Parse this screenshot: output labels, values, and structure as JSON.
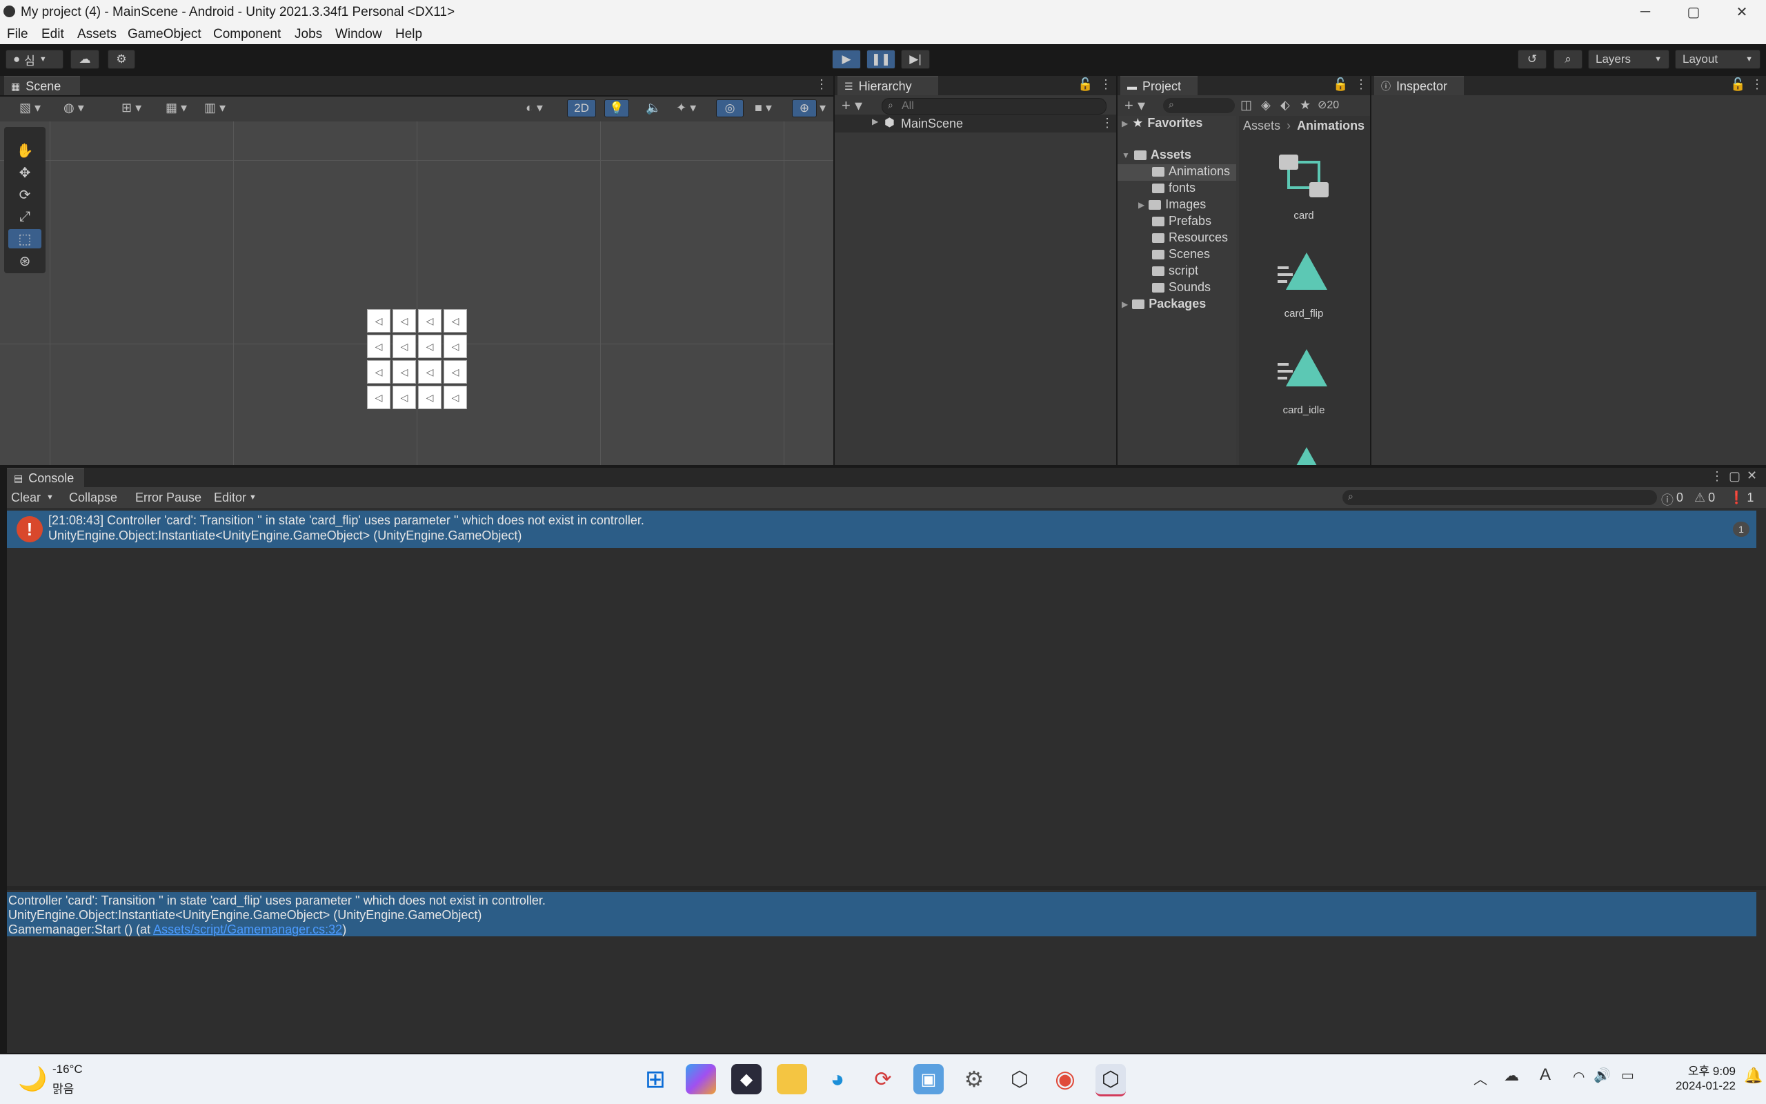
{
  "window": {
    "title": "My project (4) - MainScene - Android - Unity 2021.3.34f1 Personal <DX11>",
    "min_glyph": "─",
    "max_glyph": "▢",
    "close_glyph": "✕"
  },
  "menu": [
    "File",
    "Edit",
    "Assets",
    "GameObject",
    "Component",
    "Jobs",
    "Window",
    "Help"
  ],
  "toolbar": {
    "account_label": "심",
    "layers_label": "Layers",
    "layout_label": "Layout"
  },
  "scene": {
    "tab_label": "Scene",
    "mode_2d_label": "2D",
    "card_glyph": "◁"
  },
  "hierarchy": {
    "tab_label": "Hierarchy",
    "search_placeholder": "All",
    "root_item": "MainScene"
  },
  "project": {
    "tab_label": "Project",
    "favorites_label": "Favorites",
    "assets_label": "Assets",
    "packages_label": "Packages",
    "folders": [
      "Animations",
      "fonts",
      "Images",
      "Prefabs",
      "Resources",
      "Scenes",
      "script",
      "Sounds"
    ],
    "breadcrumb_root": "Assets",
    "breadcrumb_current": "Animations",
    "hidden_count": "20",
    "assets": [
      {
        "name": "card",
        "icon": "animator-controller-icon"
      },
      {
        "name": "card_flip",
        "icon": "animation-clip-icon"
      },
      {
        "name": "card_idle",
        "icon": "animation-clip-icon"
      }
    ]
  },
  "inspector": {
    "tab_label": "Inspector"
  },
  "console": {
    "tab_label": "Console",
    "clear_label": "Clear",
    "collapse_label": "Collapse",
    "error_pause_label": "Error Pause",
    "editor_label": "Editor",
    "info_count": "0",
    "warn_count": "0",
    "error_count": "1",
    "entry": {
      "line1": "[21:08:43] Controller 'card': Transition '' in state 'card_flip' uses parameter '' which does not exist in controller.",
      "line2": "UnityEngine.Object:Instantiate<UnityEngine.GameObject> (UnityEngine.GameObject)",
      "count": "1"
    },
    "detail": {
      "line1": "Controller 'card': Transition '' in state 'card_flip' uses parameter '' which does not exist in controller.",
      "line2": "UnityEngine.Object:Instantiate<UnityEngine.GameObject> (UnityEngine.GameObject)",
      "line3_prefix": "Gamemanager:Start () (at ",
      "line3_link": "Assets/script/Gamemanager.cs:32",
      "line3_suffix": ")"
    }
  },
  "taskbar": {
    "temperature": "-16°C",
    "weather": "맑음",
    "time": "오후 9:09",
    "date": "2024-01-22"
  },
  "colors": {
    "selection": "#2c5d87",
    "error": "#d9482c",
    "anim_teal": "#5cc8b4",
    "link": "#4c9bff"
  }
}
